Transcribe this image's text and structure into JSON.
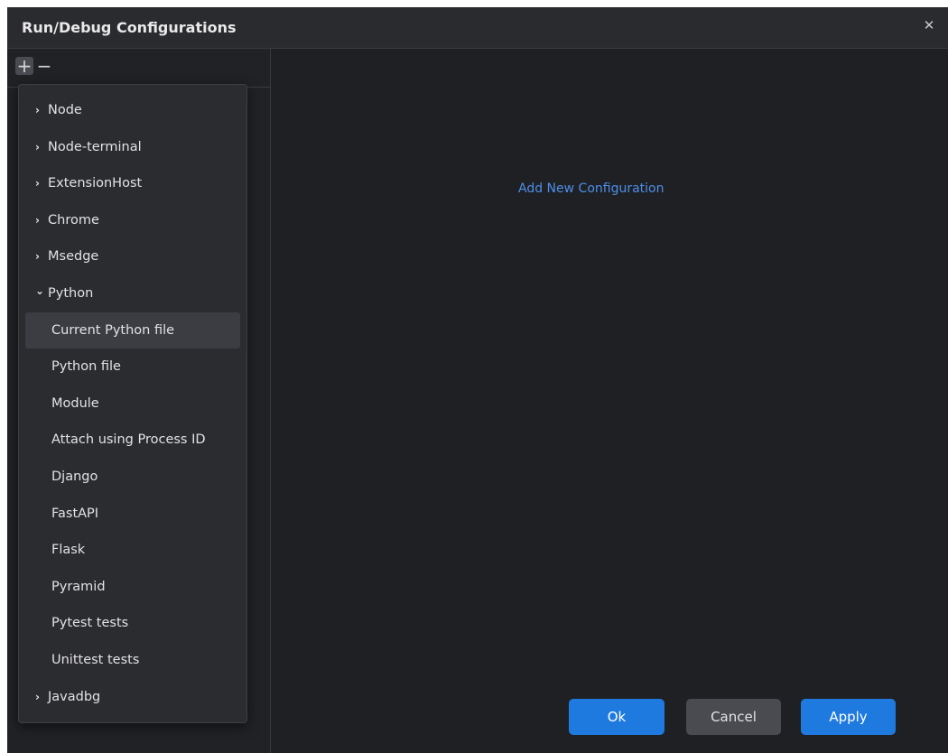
{
  "dialog": {
    "title": "Run/Debug Configurations",
    "close_glyph": "✕"
  },
  "toolbar": {
    "add_glyph": "+",
    "remove_glyph": "−"
  },
  "menu": {
    "collapsed_chevron": "›",
    "expanded_chevron": "⌄",
    "items": [
      {
        "label": "Node",
        "type": "group",
        "expanded": false
      },
      {
        "label": "Node-terminal",
        "type": "group",
        "expanded": false
      },
      {
        "label": "ExtensionHost",
        "type": "group",
        "expanded": false
      },
      {
        "label": "Chrome",
        "type": "group",
        "expanded": false
      },
      {
        "label": "Msedge",
        "type": "group",
        "expanded": false
      },
      {
        "label": "Python",
        "type": "group",
        "expanded": true
      },
      {
        "label": "Current Python file",
        "type": "child",
        "selected": true
      },
      {
        "label": "Python file",
        "type": "child"
      },
      {
        "label": "Module",
        "type": "child"
      },
      {
        "label": "Attach using Process ID",
        "type": "child"
      },
      {
        "label": "Django",
        "type": "child"
      },
      {
        "label": "FastAPI",
        "type": "child"
      },
      {
        "label": "Flask",
        "type": "child"
      },
      {
        "label": "Pyramid",
        "type": "child"
      },
      {
        "label": "Pytest tests",
        "type": "child"
      },
      {
        "label": "Unittest tests",
        "type": "child"
      },
      {
        "label": "Javadbg",
        "type": "group",
        "expanded": false
      }
    ]
  },
  "main": {
    "add_link": "Add New Configuration"
  },
  "buttons": {
    "ok": "Ok",
    "cancel": "Cancel",
    "apply": "Apply"
  },
  "colors": {
    "accent": "#1f7ae0",
    "link": "#4c8ee8",
    "background": "#1f2023"
  }
}
